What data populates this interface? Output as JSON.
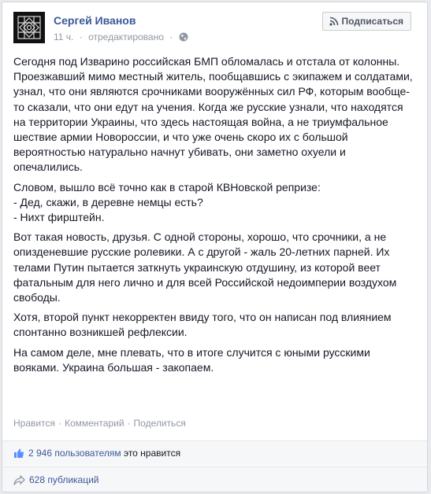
{
  "post": {
    "author": "Сергей Иванов",
    "time": "11 ч.",
    "edited": "отредактировано",
    "meta_sep": "·",
    "subscribe_label": "Подписаться",
    "paragraphs": [
      "Сегодня под Изварино российская БМП обломалась и отстала от колонны. Проезжавший мимо местный житель, пообщавшись с экипажем и солдатами, узнал, что они являются срочниками вооружённых сил РФ, которым вообще-то сказали, что они едут на учения. Когда же русские узнали, что находятся на территории Украины, что здесь настоящая война, а не триумфальное шествие армии Новороссии, и что уже очень скоро их с большой вероятностью натурально начнут убивать, они заметно охуели и опечалились.",
      "Словом, вышло всё точно как в старой КВНовской репризе:\n- Дед, скажи, в деревне немцы есть?\n- Нихт фирштейн.",
      "Вот такая новость, друзья. С одной стороны, хорошо, что срочники, а не опизденевшие русские ролевики. А с другой - жаль 20-летних парней. Их телами Путин пытается заткнуть украинскую отдушину, из которой веет фатальным для него лично и для всей Российской недоимперии воздухом свободы.",
      "Хотя, второй пункт некорректен ввиду того, что он написан под влиянием спонтанно возникшей рефлексии.",
      "На самом деле, мне плевать, что в итоге случится с юными русскими вояками. Украина большая - закопаем."
    ],
    "actions": {
      "like": "Нравится",
      "comment": "Комментарий",
      "share": "Поделиться",
      "sep": "·"
    },
    "likes": {
      "count_text": "2 946 пользователям",
      "suffix": "это нравится"
    },
    "shares": {
      "text": "628 публикаций"
    }
  }
}
